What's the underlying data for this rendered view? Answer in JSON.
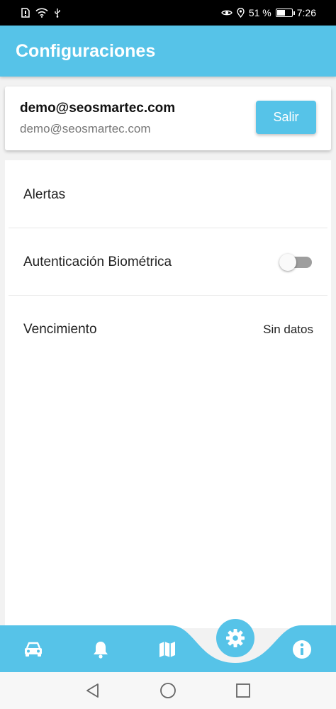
{
  "status_bar": {
    "battery_percent": "51 %",
    "battery_level": 0.51,
    "time": "7:26",
    "left_icons": [
      "sim-alert-icon",
      "wifi-icon",
      "usb-icon"
    ],
    "right_icons": [
      "eye-icon",
      "location-icon",
      "battery-icon"
    ]
  },
  "app_bar": {
    "title": "Configuraciones"
  },
  "account": {
    "name": "demo@seosmartec.com",
    "email": "demo@seosmartec.com",
    "logout_label": "Salir"
  },
  "settings": {
    "alerts_label": "Alertas",
    "biometric_label": "Autenticación Biométrica",
    "biometric_enabled": false,
    "expiry_label": "Vencimiento",
    "expiry_value": "Sin datos"
  },
  "bottom_nav": {
    "items": [
      "car-icon",
      "bell-icon",
      "map-icon",
      "gear-icon",
      "info-icon"
    ],
    "active": "gear-icon"
  },
  "colors": {
    "accent": "#56c3e8",
    "background": "#f2f2f2",
    "toggle_off": "#9e9e9e"
  }
}
